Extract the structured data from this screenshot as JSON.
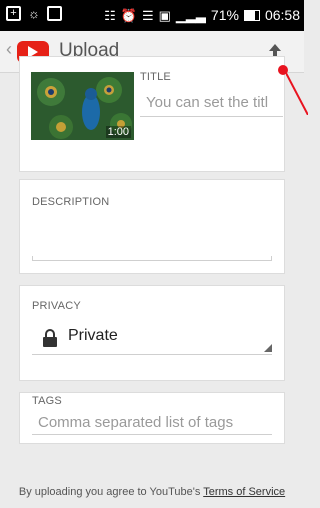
{
  "status_bar": {
    "battery": "71%",
    "time": "06:58"
  },
  "appbar": {
    "back": "‹",
    "title": "Upload"
  },
  "video": {
    "duration": "1:00"
  },
  "fields": {
    "title_label": "TITLE",
    "title_placeholder": "You can set the titl",
    "description_label": "DESCRIPTION",
    "privacy_label": "PRIVACY",
    "privacy_value": "Private",
    "tags_label": "TAGS",
    "tags_placeholder": "Comma separated list of tags"
  },
  "footer": {
    "prefix": "By uploading you agree to YouTube's ",
    "link": "Terms of Service"
  },
  "colors": {
    "brand_red": "#e62117",
    "annotation": "#e8131f"
  }
}
